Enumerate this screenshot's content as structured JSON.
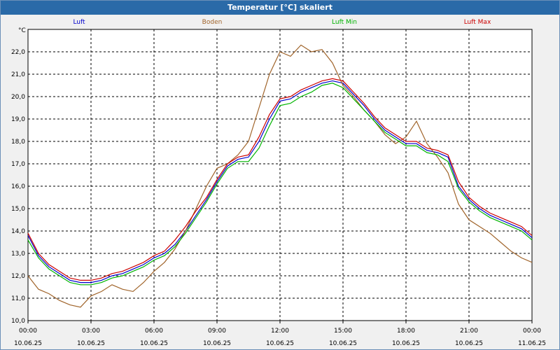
{
  "window": {
    "title": "Temperatur [°C] skaliert"
  },
  "chart_data": {
    "type": "line",
    "title": "Temperatur [°C] skaliert",
    "ylabel": "°C",
    "xlabel": "",
    "xlim": [
      0,
      24
    ],
    "ylim": [
      10.0,
      23.0
    ],
    "grid": true,
    "legend_position": "top",
    "yticks": [
      "10,0",
      "11,0",
      "12,0",
      "13,0",
      "14,0",
      "15,0",
      "16,0",
      "17,0",
      "18,0",
      "19,0",
      "20,0",
      "21,0",
      "22,0"
    ],
    "xticks": [
      {
        "time": "00:00",
        "date": "10.06.25"
      },
      {
        "time": "03:00",
        "date": "10.06.25"
      },
      {
        "time": "06:00",
        "date": "10.06.25"
      },
      {
        "time": "09:00",
        "date": "10.06.25"
      },
      {
        "time": "12:00",
        "date": "10.06.25"
      },
      {
        "time": "15:00",
        "date": "10.06.25"
      },
      {
        "time": "18:00",
        "date": "10.06.25"
      },
      {
        "time": "21:00",
        "date": "10.06.25"
      },
      {
        "time": "00:00",
        "date": "11.06.25"
      }
    ],
    "series": [
      {
        "name": "Luft",
        "color": "#0000cc",
        "x": [
          0,
          0.5,
          1,
          1.5,
          2,
          2.5,
          3,
          3.5,
          4,
          4.5,
          5,
          5.5,
          6,
          6.5,
          7,
          7.5,
          8,
          8.5,
          9,
          9.5,
          10,
          10.5,
          11,
          11.5,
          12,
          12.5,
          13,
          13.5,
          14,
          14.5,
          15,
          15.5,
          16,
          16.5,
          17,
          17.5,
          18,
          18.5,
          19,
          19.5,
          20,
          20.5,
          21,
          21.5,
          22,
          22.5,
          23,
          23.5,
          24
        ],
        "y": [
          13.8,
          12.9,
          12.4,
          12.1,
          11.8,
          11.7,
          11.7,
          11.8,
          12.0,
          12.1,
          12.3,
          12.5,
          12.8,
          13.0,
          13.4,
          14.0,
          14.7,
          15.4,
          16.2,
          16.9,
          17.2,
          17.3,
          18.0,
          19.0,
          19.8,
          19.9,
          20.2,
          20.4,
          20.6,
          20.7,
          20.6,
          20.1,
          19.6,
          19.0,
          18.5,
          18.2,
          17.9,
          17.9,
          17.6,
          17.5,
          17.3,
          16.0,
          15.4,
          15.0,
          14.7,
          14.5,
          14.3,
          14.1,
          13.7
        ]
      },
      {
        "name": "Boden",
        "color": "#a0642a",
        "x": [
          0,
          0.5,
          1,
          1.5,
          2,
          2.5,
          3,
          3.5,
          4,
          4.5,
          5,
          5.5,
          6,
          6.5,
          7,
          7.5,
          8,
          8.5,
          9,
          9.5,
          10,
          10.5,
          11,
          11.5,
          12,
          12.5,
          13,
          13.5,
          14,
          14.5,
          15,
          15.5,
          16,
          16.5,
          17,
          17.5,
          18,
          18.5,
          19,
          19.5,
          20,
          20.5,
          21,
          21.5,
          22,
          22.5,
          23,
          23.5,
          24
        ],
        "y": [
          12.0,
          11.4,
          11.2,
          10.9,
          10.7,
          10.6,
          11.1,
          11.3,
          11.6,
          11.4,
          11.3,
          11.7,
          12.2,
          12.6,
          13.2,
          14.0,
          15.0,
          16.0,
          16.8,
          17.0,
          17.4,
          18.0,
          19.5,
          21.0,
          22.0,
          21.8,
          22.3,
          22.0,
          22.1,
          21.5,
          20.5,
          20.0,
          19.4,
          18.9,
          18.3,
          17.9,
          18.2,
          18.9,
          17.9,
          17.3,
          16.6,
          15.2,
          14.5,
          14.2,
          13.9,
          13.5,
          13.1,
          12.8,
          12.6
        ]
      },
      {
        "name": "Luft Min",
        "color": "#00b400",
        "x": [
          0,
          0.5,
          1,
          1.5,
          2,
          2.5,
          3,
          3.5,
          4,
          4.5,
          5,
          5.5,
          6,
          6.5,
          7,
          7.5,
          8,
          8.5,
          9,
          9.5,
          10,
          10.5,
          11,
          11.5,
          12,
          12.5,
          13,
          13.5,
          14,
          14.5,
          15,
          15.5,
          16,
          16.5,
          17,
          17.5,
          18,
          18.5,
          19,
          19.5,
          20,
          20.5,
          21,
          21.5,
          22,
          22.5,
          23,
          23.5,
          24
        ],
        "y": [
          13.6,
          12.8,
          12.3,
          12.0,
          11.7,
          11.6,
          11.6,
          11.7,
          11.9,
          12.0,
          12.2,
          12.4,
          12.7,
          12.9,
          13.3,
          13.9,
          14.6,
          15.3,
          16.1,
          16.8,
          17.1,
          17.1,
          17.7,
          18.7,
          19.6,
          19.7,
          20.0,
          20.2,
          20.5,
          20.6,
          20.4,
          19.9,
          19.4,
          18.9,
          18.4,
          18.1,
          17.8,
          17.8,
          17.5,
          17.4,
          17.1,
          15.9,
          15.3,
          14.9,
          14.6,
          14.4,
          14.2,
          14.0,
          13.6
        ]
      },
      {
        "name": "Luft Max",
        "color": "#cc0000",
        "x": [
          0,
          0.5,
          1,
          1.5,
          2,
          2.5,
          3,
          3.5,
          4,
          4.5,
          5,
          5.5,
          6,
          6.5,
          7,
          7.5,
          8,
          8.5,
          9,
          9.5,
          10,
          10.5,
          11,
          11.5,
          12,
          12.5,
          13,
          13.5,
          14,
          14.5,
          15,
          15.5,
          16,
          16.5,
          17,
          17.5,
          18,
          18.5,
          19,
          19.5,
          20,
          20.5,
          21,
          21.5,
          22,
          22.5,
          23,
          23.5,
          24
        ],
        "y": [
          13.9,
          13.0,
          12.5,
          12.2,
          11.9,
          11.8,
          11.8,
          11.9,
          12.1,
          12.2,
          12.4,
          12.6,
          12.9,
          13.1,
          13.6,
          14.2,
          14.9,
          15.5,
          16.3,
          17.0,
          17.3,
          17.4,
          18.2,
          19.2,
          19.9,
          20.0,
          20.3,
          20.5,
          20.7,
          20.8,
          20.7,
          20.2,
          19.7,
          19.1,
          18.6,
          18.3,
          18.0,
          18.0,
          17.7,
          17.6,
          17.4,
          16.2,
          15.5,
          15.1,
          14.8,
          14.6,
          14.4,
          14.2,
          13.8
        ]
      }
    ]
  }
}
